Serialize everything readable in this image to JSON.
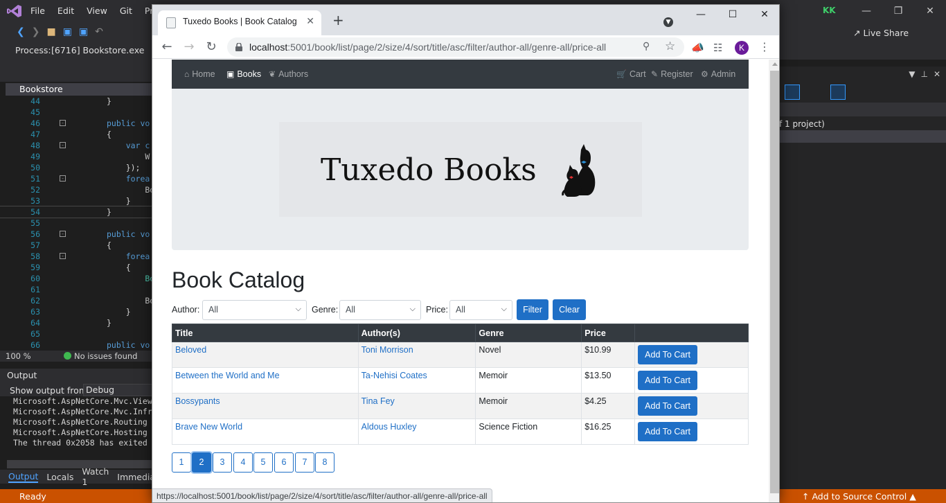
{
  "vs": {
    "menus": [
      "File",
      "Edit",
      "View",
      "Git",
      "Pro"
    ],
    "user_initials": "KK",
    "live_share": "Live Share",
    "process_label": "Process:",
    "process_value": "[6716] Bookstore.exe",
    "doc_tab": "Bookstore",
    "code_lines": [
      {
        "n": "44",
        "t": "}"
      },
      {
        "n": "45",
        "t": ""
      },
      {
        "n": "46",
        "t": "public vo"
      },
      {
        "n": "47",
        "t": "{"
      },
      {
        "n": "48",
        "t": "    var c"
      },
      {
        "n": "49",
        "t": "        W"
      },
      {
        "n": "50",
        "t": "    });"
      },
      {
        "n": "51",
        "t": "    forea"
      },
      {
        "n": "52",
        "t": "        Bo"
      },
      {
        "n": "53",
        "t": "    }"
      },
      {
        "n": "54",
        "t": "}"
      },
      {
        "n": "55",
        "t": ""
      },
      {
        "n": "56",
        "t": "public vo"
      },
      {
        "n": "57",
        "t": "{"
      },
      {
        "n": "58",
        "t": "    forea"
      },
      {
        "n": "59",
        "t": "    {"
      },
      {
        "n": "60",
        "t": "        Bo"
      },
      {
        "n": "61",
        "t": ""
      },
      {
        "n": "62",
        "t": "        Bo"
      },
      {
        "n": "63",
        "t": "    }"
      },
      {
        "n": "64",
        "t": "}"
      },
      {
        "n": "65",
        "t": ""
      },
      {
        "n": "66",
        "t": "public vo"
      }
    ],
    "zoom": "100 %",
    "issues": "No issues found",
    "output_title": "Output",
    "show_output_label": "Show output from:",
    "show_output_value": "Debug",
    "output_lines": [
      "Microsoft.AspNetCore.Mvc.View",
      "Microsoft.AspNetCore.Mvc.Infr",
      "Microsoft.AspNetCore.Routing",
      "Microsoft.AspNetCore.Hosting",
      "The thread 0x2058 has exited"
    ],
    "bottom_tabs": [
      "Output",
      "Locals",
      "Watch 1",
      "Immediate"
    ],
    "status_ready": "Ready",
    "status_source": "Add to Source Control",
    "solution_text": "f 1 project)"
  },
  "browser": {
    "tab_title": "Tuxedo Books | Book Catalog",
    "url_host": "localhost",
    "url_rest": ":5001/book/list/page/2/size/4/sort/title/asc/filter/author-all/genre-all/price-all",
    "avatar_letter": "K",
    "hover_url": "https://localhost:5001/book/list/page/2/size/4/sort/title/asc/filter/author-all/genre-all/price-all"
  },
  "site": {
    "nav_left": [
      {
        "label": "Home",
        "icon": "home-icon",
        "active": false
      },
      {
        "label": "Books",
        "icon": "book-icon",
        "active": true
      },
      {
        "label": "Authors",
        "icon": "feather-icon",
        "active": false
      }
    ],
    "nav_right": [
      {
        "label": "Cart",
        "icon": "cart-icon"
      },
      {
        "label": "Register",
        "icon": "edit-icon"
      },
      {
        "label": "Admin",
        "icon": "gear-icon"
      }
    ],
    "logo_text": "Tuxedo Books",
    "heading": "Book Catalog",
    "filters": {
      "author_label": "Author:",
      "author_value": "All",
      "genre_label": "Genre:",
      "genre_value": "All",
      "price_label": "Price:",
      "price_value": "All",
      "filter_button": "Filter",
      "clear_button": "Clear"
    },
    "table": {
      "headers": [
        "Title",
        "Author(s)",
        "Genre",
        "Price",
        ""
      ],
      "rows": [
        {
          "title": "Beloved",
          "author": "Toni Morrison",
          "genre": "Novel",
          "price": "$10.99",
          "button": "Add To Cart"
        },
        {
          "title": "Between the World and Me",
          "author": "Ta-Nehisi Coates",
          "genre": "Memoir",
          "price": "$13.50",
          "button": "Add To Cart"
        },
        {
          "title": "Bossypants",
          "author": "Tina Fey",
          "genre": "Memoir",
          "price": "$4.25",
          "button": "Add To Cart"
        },
        {
          "title": "Brave New World",
          "author": "Aldous Huxley",
          "genre": "Science Fiction",
          "price": "$16.25",
          "button": "Add To Cart"
        }
      ]
    },
    "pages": [
      "1",
      "2",
      "3",
      "4",
      "5",
      "6",
      "7",
      "8"
    ],
    "current_page": "2"
  },
  "colors": {
    "vs_status": "#ca5100",
    "navbar": "#343a40",
    "primary": "#1f6fc6"
  }
}
